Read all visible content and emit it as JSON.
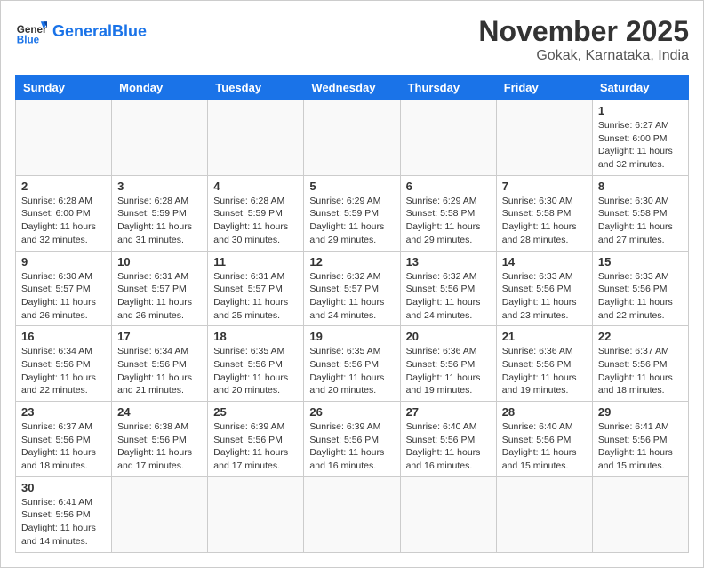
{
  "header": {
    "logo_general": "General",
    "logo_blue": "Blue",
    "month_title": "November 2025",
    "subtitle": "Gokak, Karnataka, India"
  },
  "weekdays": [
    "Sunday",
    "Monday",
    "Tuesday",
    "Wednesday",
    "Thursday",
    "Friday",
    "Saturday"
  ],
  "weeks": [
    [
      {
        "day": "",
        "sunrise": "",
        "sunset": "",
        "daylight": ""
      },
      {
        "day": "",
        "sunrise": "",
        "sunset": "",
        "daylight": ""
      },
      {
        "day": "",
        "sunrise": "",
        "sunset": "",
        "daylight": ""
      },
      {
        "day": "",
        "sunrise": "",
        "sunset": "",
        "daylight": ""
      },
      {
        "day": "",
        "sunrise": "",
        "sunset": "",
        "daylight": ""
      },
      {
        "day": "",
        "sunrise": "",
        "sunset": "",
        "daylight": ""
      },
      {
        "day": "1",
        "sunrise": "Sunrise: 6:27 AM",
        "sunset": "Sunset: 6:00 PM",
        "daylight": "Daylight: 11 hours and 32 minutes."
      }
    ],
    [
      {
        "day": "2",
        "sunrise": "Sunrise: 6:28 AM",
        "sunset": "Sunset: 6:00 PM",
        "daylight": "Daylight: 11 hours and 32 minutes."
      },
      {
        "day": "3",
        "sunrise": "Sunrise: 6:28 AM",
        "sunset": "Sunset: 5:59 PM",
        "daylight": "Daylight: 11 hours and 31 minutes."
      },
      {
        "day": "4",
        "sunrise": "Sunrise: 6:28 AM",
        "sunset": "Sunset: 5:59 PM",
        "daylight": "Daylight: 11 hours and 30 minutes."
      },
      {
        "day": "5",
        "sunrise": "Sunrise: 6:29 AM",
        "sunset": "Sunset: 5:59 PM",
        "daylight": "Daylight: 11 hours and 29 minutes."
      },
      {
        "day": "6",
        "sunrise": "Sunrise: 6:29 AM",
        "sunset": "Sunset: 5:58 PM",
        "daylight": "Daylight: 11 hours and 29 minutes."
      },
      {
        "day": "7",
        "sunrise": "Sunrise: 6:30 AM",
        "sunset": "Sunset: 5:58 PM",
        "daylight": "Daylight: 11 hours and 28 minutes."
      },
      {
        "day": "8",
        "sunrise": "Sunrise: 6:30 AM",
        "sunset": "Sunset: 5:58 PM",
        "daylight": "Daylight: 11 hours and 27 minutes."
      }
    ],
    [
      {
        "day": "9",
        "sunrise": "Sunrise: 6:30 AM",
        "sunset": "Sunset: 5:57 PM",
        "daylight": "Daylight: 11 hours and 26 minutes."
      },
      {
        "day": "10",
        "sunrise": "Sunrise: 6:31 AM",
        "sunset": "Sunset: 5:57 PM",
        "daylight": "Daylight: 11 hours and 26 minutes."
      },
      {
        "day": "11",
        "sunrise": "Sunrise: 6:31 AM",
        "sunset": "Sunset: 5:57 PM",
        "daylight": "Daylight: 11 hours and 25 minutes."
      },
      {
        "day": "12",
        "sunrise": "Sunrise: 6:32 AM",
        "sunset": "Sunset: 5:57 PM",
        "daylight": "Daylight: 11 hours and 24 minutes."
      },
      {
        "day": "13",
        "sunrise": "Sunrise: 6:32 AM",
        "sunset": "Sunset: 5:56 PM",
        "daylight": "Daylight: 11 hours and 24 minutes."
      },
      {
        "day": "14",
        "sunrise": "Sunrise: 6:33 AM",
        "sunset": "Sunset: 5:56 PM",
        "daylight": "Daylight: 11 hours and 23 minutes."
      },
      {
        "day": "15",
        "sunrise": "Sunrise: 6:33 AM",
        "sunset": "Sunset: 5:56 PM",
        "daylight": "Daylight: 11 hours and 22 minutes."
      }
    ],
    [
      {
        "day": "16",
        "sunrise": "Sunrise: 6:34 AM",
        "sunset": "Sunset: 5:56 PM",
        "daylight": "Daylight: 11 hours and 22 minutes."
      },
      {
        "day": "17",
        "sunrise": "Sunrise: 6:34 AM",
        "sunset": "Sunset: 5:56 PM",
        "daylight": "Daylight: 11 hours and 21 minutes."
      },
      {
        "day": "18",
        "sunrise": "Sunrise: 6:35 AM",
        "sunset": "Sunset: 5:56 PM",
        "daylight": "Daylight: 11 hours and 20 minutes."
      },
      {
        "day": "19",
        "sunrise": "Sunrise: 6:35 AM",
        "sunset": "Sunset: 5:56 PM",
        "daylight": "Daylight: 11 hours and 20 minutes."
      },
      {
        "day": "20",
        "sunrise": "Sunrise: 6:36 AM",
        "sunset": "Sunset: 5:56 PM",
        "daylight": "Daylight: 11 hours and 19 minutes."
      },
      {
        "day": "21",
        "sunrise": "Sunrise: 6:36 AM",
        "sunset": "Sunset: 5:56 PM",
        "daylight": "Daylight: 11 hours and 19 minutes."
      },
      {
        "day": "22",
        "sunrise": "Sunrise: 6:37 AM",
        "sunset": "Sunset: 5:56 PM",
        "daylight": "Daylight: 11 hours and 18 minutes."
      }
    ],
    [
      {
        "day": "23",
        "sunrise": "Sunrise: 6:37 AM",
        "sunset": "Sunset: 5:56 PM",
        "daylight": "Daylight: 11 hours and 18 minutes."
      },
      {
        "day": "24",
        "sunrise": "Sunrise: 6:38 AM",
        "sunset": "Sunset: 5:56 PM",
        "daylight": "Daylight: 11 hours and 17 minutes."
      },
      {
        "day": "25",
        "sunrise": "Sunrise: 6:39 AM",
        "sunset": "Sunset: 5:56 PM",
        "daylight": "Daylight: 11 hours and 17 minutes."
      },
      {
        "day": "26",
        "sunrise": "Sunrise: 6:39 AM",
        "sunset": "Sunset: 5:56 PM",
        "daylight": "Daylight: 11 hours and 16 minutes."
      },
      {
        "day": "27",
        "sunrise": "Sunrise: 6:40 AM",
        "sunset": "Sunset: 5:56 PM",
        "daylight": "Daylight: 11 hours and 16 minutes."
      },
      {
        "day": "28",
        "sunrise": "Sunrise: 6:40 AM",
        "sunset": "Sunset: 5:56 PM",
        "daylight": "Daylight: 11 hours and 15 minutes."
      },
      {
        "day": "29",
        "sunrise": "Sunrise: 6:41 AM",
        "sunset": "Sunset: 5:56 PM",
        "daylight": "Daylight: 11 hours and 15 minutes."
      }
    ],
    [
      {
        "day": "30",
        "sunrise": "Sunrise: 6:41 AM",
        "sunset": "Sunset: 5:56 PM",
        "daylight": "Daylight: 11 hours and 14 minutes."
      },
      {
        "day": "",
        "sunrise": "",
        "sunset": "",
        "daylight": ""
      },
      {
        "day": "",
        "sunrise": "",
        "sunset": "",
        "daylight": ""
      },
      {
        "day": "",
        "sunrise": "",
        "sunset": "",
        "daylight": ""
      },
      {
        "day": "",
        "sunrise": "",
        "sunset": "",
        "daylight": ""
      },
      {
        "day": "",
        "sunrise": "",
        "sunset": "",
        "daylight": ""
      },
      {
        "day": "",
        "sunrise": "",
        "sunset": "",
        "daylight": ""
      }
    ]
  ]
}
